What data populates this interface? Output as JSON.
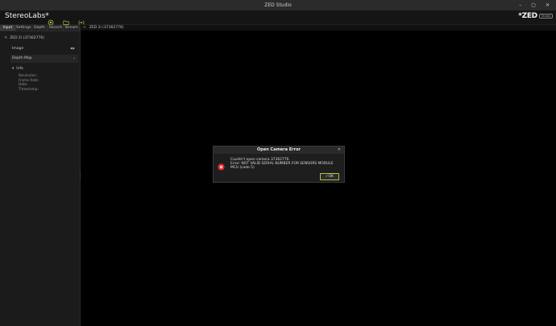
{
  "window": {
    "title": "ZED Studio",
    "controls": [
      "–",
      "▢",
      "✕"
    ]
  },
  "header": {
    "brand": "StereoLabs*",
    "icons": [
      "record-icon",
      "folder-icon",
      "network-icon"
    ],
    "logo": {
      "mark": "*ZED",
      "tag": "Studio"
    }
  },
  "sidebar": {
    "tabs": [
      {
        "label": "Input",
        "active": true
      },
      {
        "label": "Settings",
        "active": false
      },
      {
        "label": "Depth",
        "active": false
      },
      {
        "label": "Record",
        "active": false
      },
      {
        "label": "Stream",
        "active": false
      }
    ],
    "camera": "ZED 2i (37362776)",
    "image_label": "Image",
    "view_select": "Depth Map",
    "info": {
      "heading": "Info",
      "items": [
        "Resolution:",
        "Frame Rate:",
        "Date:",
        "Timestamp:"
      ]
    }
  },
  "main": {
    "camera_tab": "ZED 2i (37362776)"
  },
  "dialog": {
    "title": "Open Camera Error",
    "line1": "Couldn't open camera 37362776.",
    "line2": "Error: NOT VALID SERIAL NUMBER FOR SENSORS MODULE MCU (code 5)",
    "ok_label": "OK",
    "close_glyph": "✕"
  },
  "colors": {
    "accent": "#b5bf3e",
    "error": "#d9262c"
  }
}
